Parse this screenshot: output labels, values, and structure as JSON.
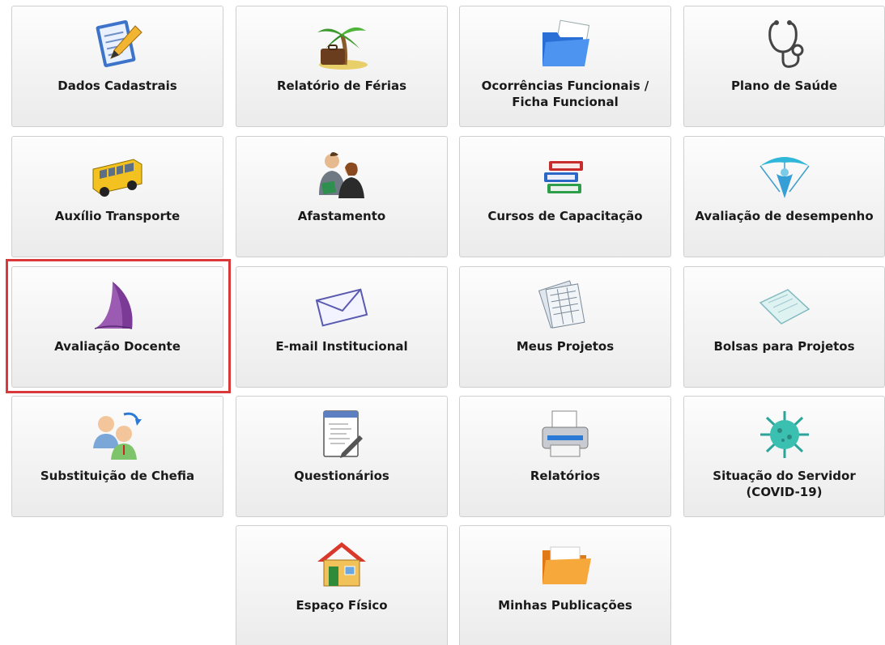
{
  "tiles": [
    {
      "label": "Dados Cadastrais",
      "icon": "notepad-pencil-icon"
    },
    {
      "label": "Relatório de Férias",
      "icon": "palm-tree-suitcase-icon"
    },
    {
      "label": "Ocorrências Funcionais /\nFicha Funcional",
      "icon": "blue-folder-icon"
    },
    {
      "label": "Plano de Saúde",
      "icon": "stethoscope-icon"
    },
    {
      "label": "Auxílio Transporte",
      "icon": "school-bus-icon"
    },
    {
      "label": "Afastamento",
      "icon": "people-books-icon"
    },
    {
      "label": "Cursos de Capacitação",
      "icon": "book-stack-icon"
    },
    {
      "label": "Avaliação de desempenho",
      "icon": "parachute-icon"
    },
    {
      "label": "Avaliação Docente",
      "icon": "purple-sail-icon"
    },
    {
      "label": "E-mail Institucional",
      "icon": "envelope-icon"
    },
    {
      "label": "Meus Projetos",
      "icon": "spreadsheet-papers-icon"
    },
    {
      "label": "Bolsas para Projetos",
      "icon": "paper-sheet-icon"
    },
    {
      "label": "Substituição de Chefia",
      "icon": "user-swap-icon"
    },
    {
      "label": "Questionários",
      "icon": "code-document-icon"
    },
    {
      "label": "Relatórios",
      "icon": "printer-icon"
    },
    {
      "label": "Situação do Servidor\n(COVID-19)",
      "icon": "virus-icon"
    },
    {
      "label": "Espaço Físico",
      "icon": "house-icon"
    },
    {
      "label": "Minhas Publicações",
      "icon": "orange-folder-icon"
    }
  ],
  "highlighted_tile": "Avaliação Docente",
  "colors": {
    "highlight_border": "#d9393b",
    "tile_border": "#cfcfcf",
    "label_text": "#1a1a1a"
  }
}
